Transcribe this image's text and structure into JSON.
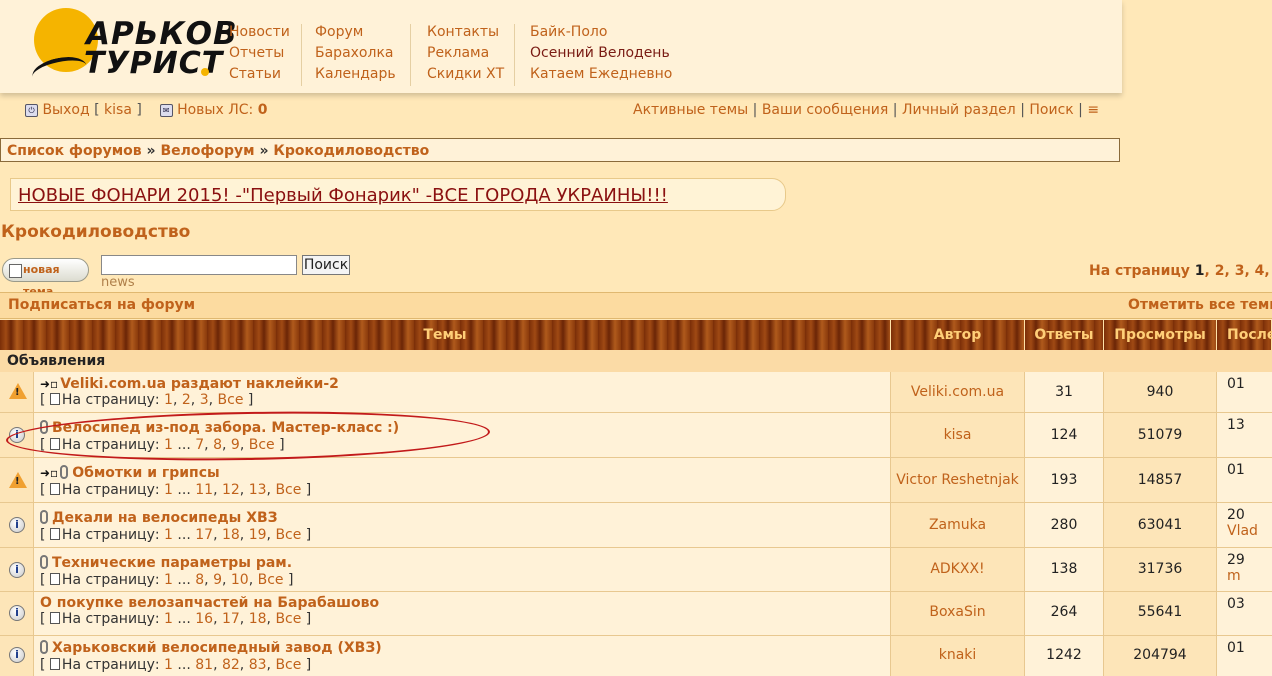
{
  "logo": {
    "line1": "АРЬКОВ",
    "line2": "ТУРИСТ"
  },
  "nav": [
    {
      "items": [
        {
          "label": "Новости"
        },
        {
          "label": "Отчеты"
        },
        {
          "label": "Статьи"
        }
      ]
    },
    {
      "items": [
        {
          "label": "Форум"
        },
        {
          "label": "Барахолка"
        },
        {
          "label": "Календарь"
        }
      ]
    },
    {
      "items": [
        {
          "label": "Контакты"
        },
        {
          "label": "Реклама"
        },
        {
          "label": "Скидки ХТ"
        }
      ]
    },
    {
      "items": [
        {
          "label": "Байк-Поло"
        },
        {
          "label": "Осенний Велодень"
        },
        {
          "label": "Катаем Ежедневно"
        }
      ]
    }
  ],
  "user_bar": {
    "logout_label": "Выход",
    "username": "kisa",
    "pm_label": "Новых ЛС:",
    "pm_count": "0"
  },
  "quick_links": {
    "active": "Активные темы",
    "your_posts": "Ваши сообщения",
    "ucp": "Личный раздел",
    "search": "Поиск",
    "menu": "≡"
  },
  "breadcrumb": {
    "root": "Список форумов",
    "sep": "»",
    "level1": "Велофорум",
    "level2": "Крокодиловодство"
  },
  "ad": {
    "text": "НОВЫЕ ФОНАРИ 2015! -\"Первый Фонарик\" -ВСЕ ГОРОДА УКРАИНЫ!!!"
  },
  "forum_title": "Крокодиловодство",
  "new_topic_label": "новая тема",
  "search": {
    "button_label": "Поиск",
    "hint": "news"
  },
  "pagination": {
    "label": "На страницу",
    "current": "1",
    "pages": [
      "2",
      "3",
      "4"
    ]
  },
  "subscribe_label": "Подписаться на форум",
  "mark_read_label": "Отметить все темы",
  "table": {
    "headers": {
      "topics": "Темы",
      "author": "Автор",
      "replies": "Ответы",
      "views": "Просмотры",
      "last": "После"
    },
    "section_label": "Объявления",
    "page_prefix": "На страницу:",
    "all_label": "Все",
    "rows": [
      {
        "title": "Veliki.com.ua раздают наклейки-2",
        "p1": "1",
        "p2": "2",
        "p3": "3",
        "author": "Veliki.com.ua",
        "replies": "31",
        "views": "940",
        "last1": "01",
        "last2": ""
      },
      {
        "title": "Велосипед из-под забора. Мастер-класс :)",
        "p1": "1",
        "p2": "7",
        "p3": "8",
        "p4": "9",
        "author": "kisa",
        "replies": "124",
        "views": "51079",
        "last1": "13",
        "last2": ""
      },
      {
        "title": "Обмотки и грипсы",
        "p1": "1",
        "p2": "11",
        "p3": "12",
        "p4": "13",
        "author": "Victor Reshetnjak",
        "replies": "193",
        "views": "14857",
        "last1": "01",
        "last2": ""
      },
      {
        "title": "Декали на велосипеды ХВЗ",
        "p1": "1",
        "p2": "17",
        "p3": "18",
        "p4": "19",
        "author": "Zamuka",
        "replies": "280",
        "views": "63041",
        "last1": "20",
        "last2": "Vlad"
      },
      {
        "title": "Технические параметры рам.",
        "p1": "1",
        "p2": "8",
        "p3": "9",
        "p4": "10",
        "author": "ADKXX!",
        "replies": "138",
        "views": "31736",
        "last1": "29",
        "last2": "m"
      },
      {
        "title": "О покупке велозапчастей на Барабашово",
        "p1": "1",
        "p2": "16",
        "p3": "17",
        "p4": "18",
        "author": "BoxaSin",
        "replies": "264",
        "views": "55641",
        "last1": "03",
        "last2": ""
      },
      {
        "title": "Харьковский велосипедный завод (ХВЗ)",
        "p1": "1",
        "p2": "81",
        "p3": "82",
        "p4": "83",
        "author": "knaki",
        "replies": "1242",
        "views": "204794",
        "last1": "01",
        "last2": ""
      }
    ]
  }
}
